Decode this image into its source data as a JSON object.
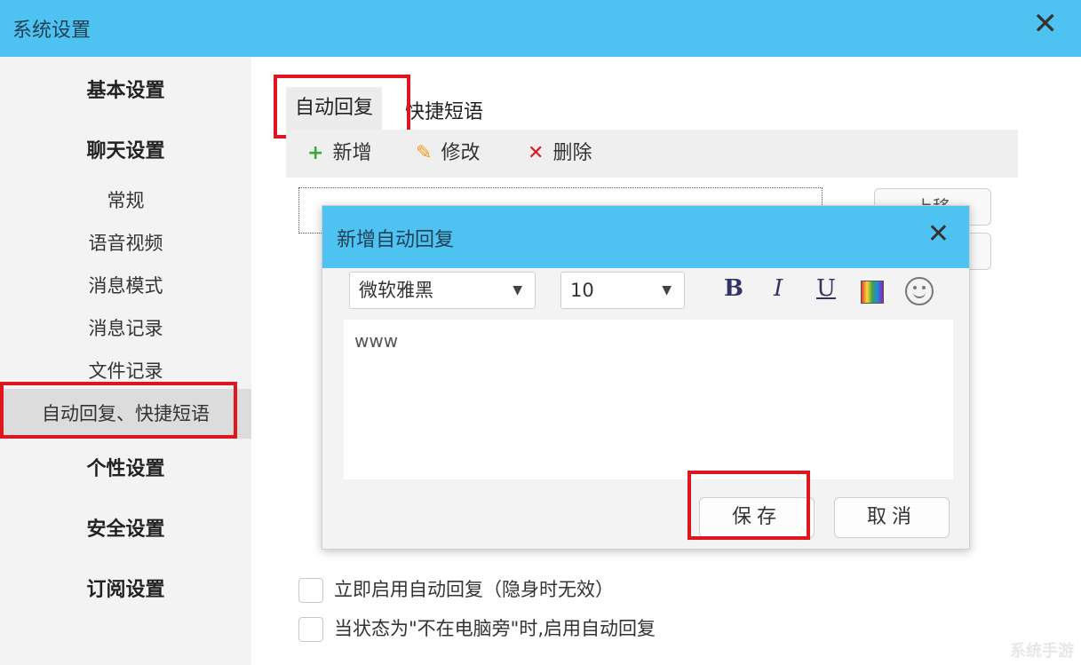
{
  "window": {
    "title": "系统设置",
    "close_icon": "close-icon"
  },
  "sidebar": {
    "groups": [
      {
        "label": "基本设置"
      },
      {
        "label": "聊天设置"
      }
    ],
    "chat_items": [
      "常规",
      "语音视频",
      "消息模式",
      "消息记录",
      "文件记录",
      "自动回复、快捷短语"
    ],
    "more_groups": [
      "个性设置",
      "安全设置",
      "订阅设置"
    ]
  },
  "main": {
    "tabs": [
      "自动回复",
      "快捷短语"
    ],
    "toolbar": {
      "add": "新增",
      "edit": "修改",
      "delete": "删除"
    },
    "side_button_top": "上移",
    "checks": [
      "立即启用自动回复（隐身时无效）",
      "当状态为\"不在电脑旁\"时,启用自动回复"
    ]
  },
  "dialog": {
    "title": "新增自动回复",
    "font": "微软雅黑",
    "size": "10",
    "format": {
      "bold": "B",
      "italic": "I",
      "underline": "U"
    },
    "editor_text": "www",
    "save": "保存",
    "cancel": "取消"
  },
  "watermark": "系统手游",
  "colors": {
    "titlebar": "#4ec3f1",
    "highlight": "#e0161e"
  }
}
